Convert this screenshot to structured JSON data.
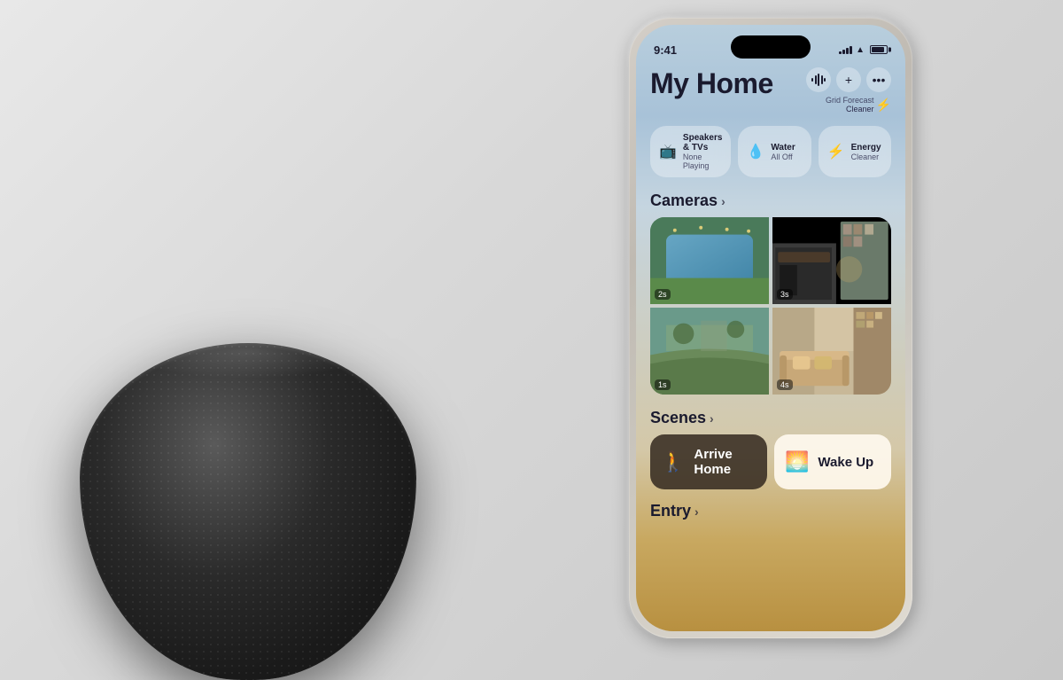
{
  "background": {
    "color": "#e8e8e4"
  },
  "status_bar": {
    "time": "9:41",
    "signal_bars": [
      3,
      5,
      7,
      9,
      11
    ],
    "wifi": "wifi",
    "battery_level": 80
  },
  "header": {
    "title": "My Home",
    "grid_forecast_label": "Grid Forecast",
    "grid_forecast_value": "Cleaner",
    "actions": {
      "waveform_label": "waveform",
      "add_label": "+",
      "more_label": "···"
    }
  },
  "quick_tiles": [
    {
      "id": "speakers",
      "icon": "🖥",
      "name": "Speakers & TVs",
      "status": "None Playing"
    },
    {
      "id": "water",
      "icon": "💧",
      "name": "Water",
      "status": "All Off"
    },
    {
      "id": "energy",
      "icon": "⚡",
      "name": "Energy",
      "status": "Cleaner"
    }
  ],
  "cameras_section": {
    "label": "Cameras",
    "chevron": "›",
    "cameras": [
      {
        "id": "cam1",
        "time": "2s",
        "description": "pool-camera"
      },
      {
        "id": "cam2",
        "time": "3s",
        "description": "indoor-bookshelf-camera"
      },
      {
        "id": "cam3",
        "time": "1s",
        "description": "garden-camera"
      },
      {
        "id": "cam4",
        "time": "4s",
        "description": "living-room-camera"
      }
    ]
  },
  "scenes_section": {
    "label": "Scenes",
    "chevron": "›",
    "scenes": [
      {
        "id": "arrive-home",
        "icon": "🚶",
        "label": "Arrive Home",
        "theme": "dark"
      },
      {
        "id": "wake-up",
        "icon": "🌅",
        "label": "Wake Up",
        "theme": "light"
      }
    ]
  },
  "entry_section": {
    "label": "Entry",
    "chevron": "›"
  }
}
